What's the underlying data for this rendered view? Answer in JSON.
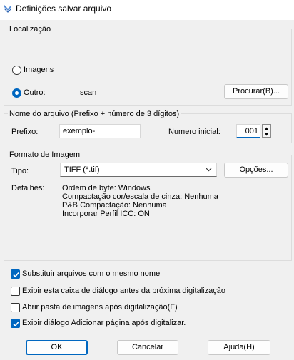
{
  "window": {
    "title": "Definições salvar arquivo"
  },
  "location": {
    "legend": "Localização",
    "option_images": "Imagens",
    "option_other": "Outro:",
    "other_value": "scan",
    "browse_label": "Procurar(B)..."
  },
  "filename": {
    "legend": "Nome do arquivo (Prefixo + número de 3 dígitos)",
    "prefix_label": "Prefixo:",
    "prefix_value": "exemplo-",
    "start_label": "Numero inicial:",
    "start_value": "001"
  },
  "format": {
    "legend": "Formato de Imagem",
    "type_label": "Tipo:",
    "type_value": "TIFF (*.tif)",
    "options_label": "Opções...",
    "details_label": "Detalhes:",
    "details": [
      "Ordem de byte: Windows",
      "Compactação cor/escala de cinza: Nenhuma",
      "P&B Compactação: Nenhuma",
      "Incorporar Perfil ICC: ON"
    ]
  },
  "checks": [
    {
      "label": "Substituir arquivos com o mesmo nome",
      "checked": true
    },
    {
      "label": "Exibir esta caixa de diálogo antes da próxima digitalização",
      "checked": false
    },
    {
      "label": "Abrir pasta de imagens após digitalização(F)",
      "checked": false
    },
    {
      "label": "Exibir diálogo Adicionar página após digitalizar.",
      "checked": true
    }
  ],
  "buttons": {
    "ok": "OK",
    "cancel": "Cancelar",
    "help": "Ajuda(H)"
  },
  "colors": {
    "accent": "#0067c0",
    "background": "#f0f0f0"
  }
}
